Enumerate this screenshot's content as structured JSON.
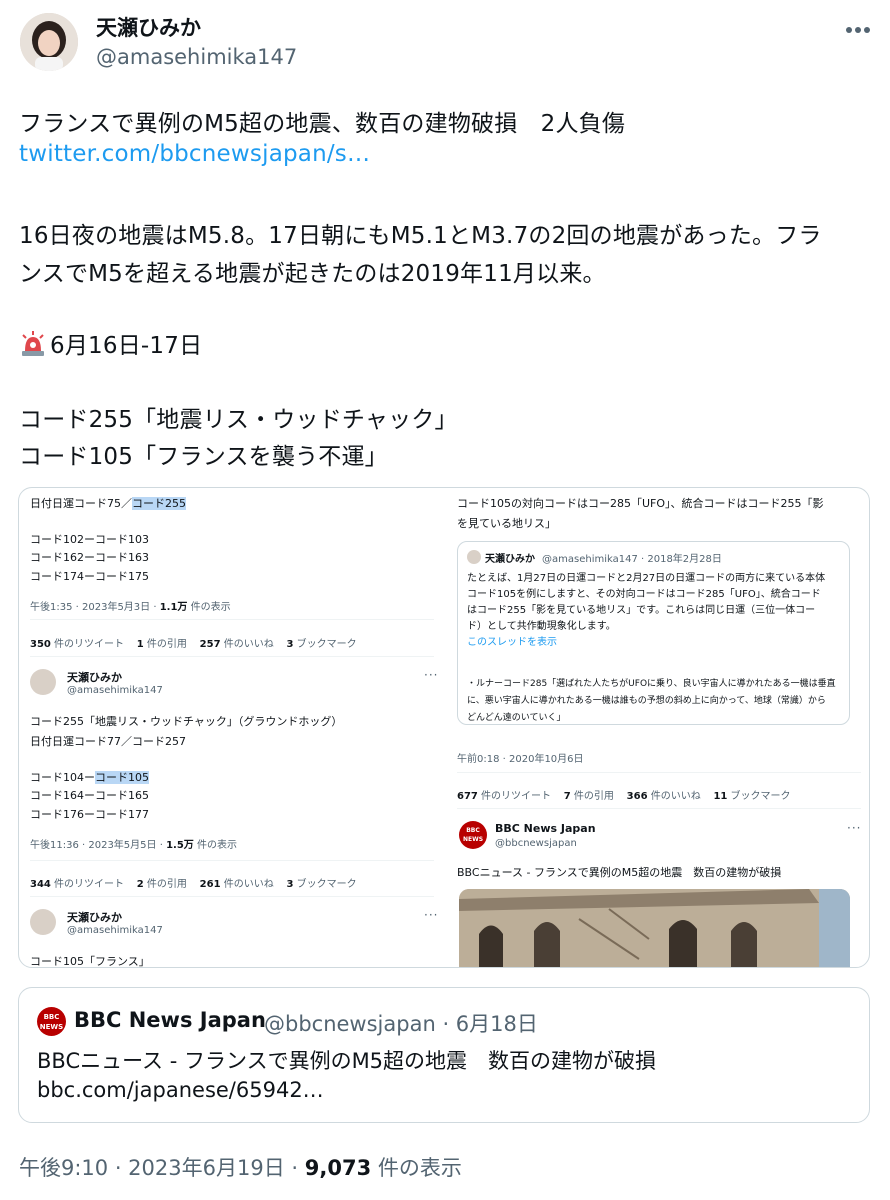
{
  "author": {
    "name": "天瀬ひみか",
    "handle": "@amasehimika147",
    "avatar_icon": "user-avatar-photo",
    "more_icon": "more-horizontal-icon"
  },
  "tweet": {
    "line1": "フランスで異例のM5超の地震、数百の建物破損　2人負傷",
    "link": "twitter.com/bbcnewsjapan/s…",
    "line3": "16日夜の地震はM5.8。17日朝にもM5.1とM3.7の2回の地震があった。フラ",
    "line4": "ンスでM5を超える地震が起きたのは2019年11月以来。",
    "siren_icon": "rotating-light-icon",
    "line5": "6月16日-17日",
    "line6": "コード255「地震リス・ウッドチャック」",
    "line7": "コード105「フランスを襲う不運」"
  },
  "collage": {
    "left": {
      "t1_a": "日付日運コード75／",
      "t1_b": "コード255",
      "t1_l2": "コード102ーコード103",
      "t1_l3": "コード162ーコード163",
      "t1_l4": "コード174ーコード175",
      "t1_time": "午後1:35 · 2023年5月3日 · ",
      "t1_views_num": "1.1万",
      "t1_views_label": " 件の表示",
      "t1_stats": [
        {
          "num": "350",
          "label": " 件のリツイート"
        },
        {
          "num": "1",
          "label": " 件の引用"
        },
        {
          "num": "257",
          "label": " 件のいいね"
        },
        {
          "num": "3",
          "label": " ブックマーク"
        }
      ],
      "t2_name": "天瀬ひみか",
      "t2_handle": "@amasehimika147",
      "t2_l1": "コード255「地震リス・ウッドチャック」（グラウンドホッグ）",
      "t2_l2": "日付日運コード77／コード257",
      "t2_l3a": "コード104ー",
      "t2_l3b": "コード105",
      "t2_l4": "コード164ーコード165",
      "t2_l5": "コード176ーコード177",
      "t2_time": "午後11:36 · 2023年5月5日 · ",
      "t2_views_num": "1.5万",
      "t2_views_label": " 件の表示",
      "t2_stats": [
        {
          "num": "344",
          "label": " 件のリツイート"
        },
        {
          "num": "2",
          "label": " 件の引用"
        },
        {
          "num": "261",
          "label": " 件のいいね"
        },
        {
          "num": "3",
          "label": " ブックマーク"
        }
      ],
      "t3_name": "天瀬ひみか",
      "t3_handle": "@amasehimika147",
      "t3_l1": "コード105「フランス」"
    },
    "right": {
      "r1_l1": "コード105の対向コードはコー285「UFO」、統合コードはコード255「影",
      "r1_l2": "を見ている地リス」",
      "q_name": "天瀬ひみか",
      "q_handle_date": "@amasehimika147 · 2018年2月28日",
      "q_l1": "たとえば、1月27日の日運コードと2月27日の日運コードの両方に来ている本体",
      "q_l2": "コード105を例にしますと、その対向コードはコード285「UFO」、統合コード",
      "q_l3": "はコード255「影を見ている地リス」です。これらは同じ日運（三位一体コー",
      "q_l4": "ド）として共作動現象化します。",
      "q_thread": "このスレッドを表示",
      "q_l5": "・ルナーコード285「選ばれた人たちがUFOに乗り、良い宇宙人に導かれたある一機は垂直",
      "q_l6": "に、悪い宇宙人に導かれたある一機は誰もの予想の斜め上に向かって、地球（常識）から",
      "q_l7": "どんどん遠のいていく」",
      "r1_time": "午前0:18 · 2020年10月6日",
      "r1_stats": [
        {
          "num": "677",
          "label": " 件のリツイート"
        },
        {
          "num": "7",
          "label": " 件の引用"
        },
        {
          "num": "366",
          "label": " 件のいいね"
        },
        {
          "num": "11",
          "label": " ブックマーク"
        }
      ],
      "bbc_logo": "BBC NEWS",
      "bbc_name": "BBC News Japan",
      "bbc_handle": "@bbcnewsjapan",
      "bbc_text": "BBCニュース - フランスで異例のM5超の地震　数百の建物が破損"
    }
  },
  "quote": {
    "logo": "BBC NEWS",
    "name": "BBC News Japan",
    "handle_date": "@bbcnewsjapan · 6月18日",
    "text": "BBCニュース - フランスで異例のM5超の地震　数百の建物が破損",
    "link": "bbc.com/japanese/65942…"
  },
  "footer": {
    "time": "午後9:10 · 2023年6月19日 · ",
    "views_num": "9,073",
    "views_label": " 件の表示"
  },
  "colors": {
    "link": "#1d9bf0",
    "secondary": "#536471",
    "border": "#cfd9de",
    "highlight": "#b9d7f5",
    "bbc": "#b80000"
  }
}
